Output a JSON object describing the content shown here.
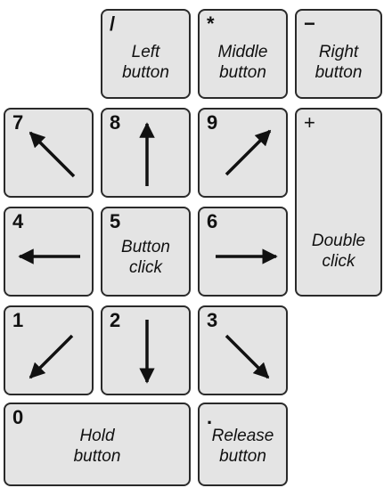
{
  "keys": {
    "divide": {
      "char": "/",
      "line1": "Left",
      "line2": "button"
    },
    "multiply": {
      "char": "*",
      "line1": "Middle",
      "line2": "button"
    },
    "minus": {
      "char": "−",
      "line1": "Right",
      "line2": "button"
    },
    "seven": {
      "char": "7"
    },
    "eight": {
      "char": "8"
    },
    "nine": {
      "char": "9"
    },
    "plus": {
      "char": "+",
      "line1": "Double",
      "line2": "click"
    },
    "four": {
      "char": "4"
    },
    "five": {
      "char": "5",
      "line1": "Button",
      "line2": "click"
    },
    "six": {
      "char": "6"
    },
    "one": {
      "char": "1"
    },
    "two": {
      "char": "2"
    },
    "three": {
      "char": "3"
    },
    "zero": {
      "char": "0",
      "line1": "Hold",
      "line2": "button"
    },
    "decimal": {
      "char": ".",
      "line1": "Release",
      "line2": "button"
    }
  },
  "icons": {
    "seven": "arrow-up-left",
    "eight": "arrow-up",
    "nine": "arrow-up-right",
    "four": "arrow-left",
    "six": "arrow-right",
    "one": "arrow-down-left",
    "two": "arrow-down",
    "three": "arrow-down-right"
  },
  "colors": {
    "key_fill": "#e4e4e4",
    "key_border": "#2a2a2a",
    "ink": "#111111"
  }
}
